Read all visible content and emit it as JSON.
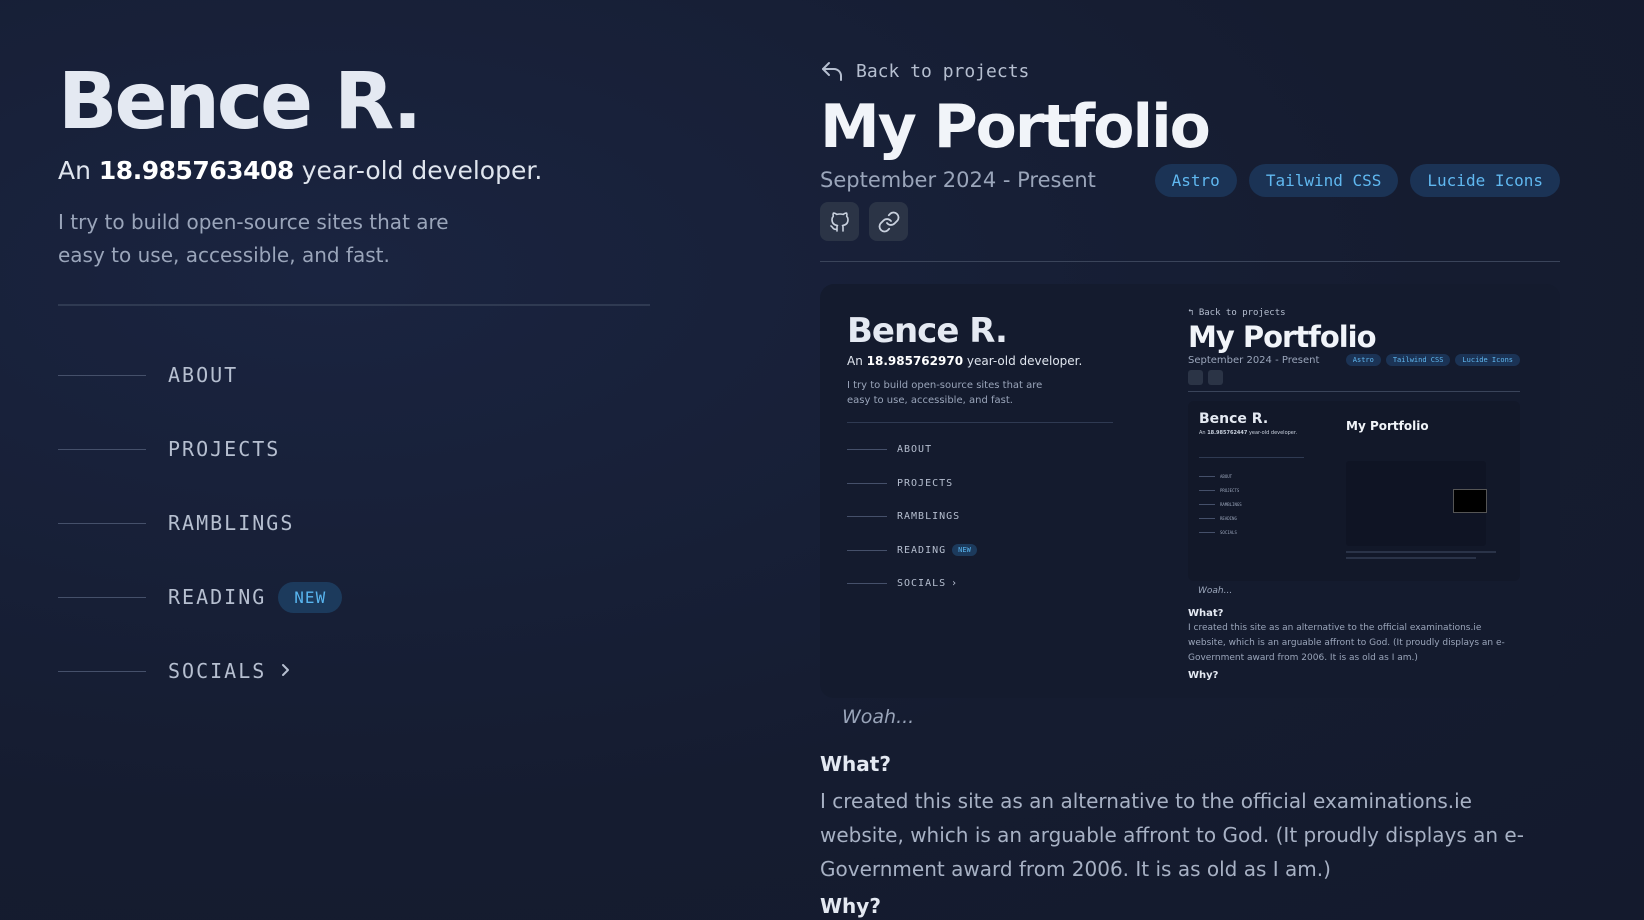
{
  "profile": {
    "name": "Bence R.",
    "tagline_prefix": "An ",
    "age": "18.985763408",
    "tagline_suffix": " year-old developer.",
    "intro": "I try to build open-source sites that are easy to use, accessible, and fast."
  },
  "nav": {
    "items": [
      {
        "label": "ABOUT"
      },
      {
        "label": "PROJECTS"
      },
      {
        "label": "RAMBLINGS"
      },
      {
        "label": "READING",
        "badge": "NEW"
      },
      {
        "label": "SOCIALS",
        "chevron": "chevron-right-icon"
      }
    ]
  },
  "project": {
    "back_label": "Back to projects",
    "title": "My Portfolio",
    "date": "September 2024 - Present",
    "tags": [
      "Astro",
      "Tailwind CSS",
      "Lucide Icons"
    ],
    "links": [
      "github-icon",
      "link-icon"
    ],
    "caption": "Woah...",
    "sections": [
      {
        "heading": "What?",
        "body": "I created this site as an alternative to the official examinations.ie website, which is an arguable affront to God. (It proudly displays an e-Government award from 2006. It is as old as I am.)"
      },
      {
        "heading": "Why?"
      }
    ]
  },
  "preview": {
    "name": "Bence R.",
    "tagline_prefix": "An ",
    "age": "18.985762970",
    "tagline_suffix": " year-old developer.",
    "intro": "I try to build open-source sites that are easy to use, accessible, and fast.",
    "nav": [
      "ABOUT",
      "PROJECTS",
      "RAMBLINGS",
      "READING",
      "SOCIALS"
    ],
    "badge": "NEW",
    "back_label": "Back to projects",
    "title": "My Portfolio",
    "date": "September 2024 - Present",
    "tags": [
      "Astro",
      "Tailwind CSS",
      "Lucide Icons"
    ],
    "caption": "Woah...",
    "what_heading": "What?",
    "what_body": "I created this site as an alternative to the official examinations.ie website, which is an arguable affront to God. (It proudly displays an e-Government award from 2006. It is as old as I am.)",
    "why_heading": "Why?",
    "inner_name": "Bence R.",
    "inner_title": "My Portfolio",
    "inner_age": "18.985762447"
  },
  "colors": {
    "background": "#161e33",
    "accent": "#60b8f0",
    "tag_bg": "#1b3355"
  }
}
